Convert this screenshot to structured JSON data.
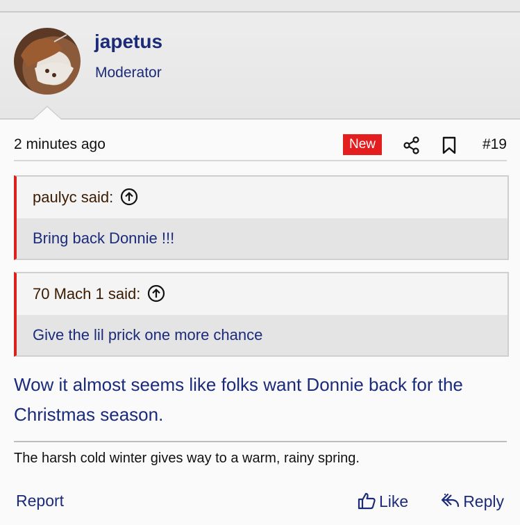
{
  "user": {
    "name": "japetus",
    "title": "Moderator"
  },
  "post": {
    "time": "2 minutes ago",
    "badge": "New",
    "number": "#19",
    "quotes": [
      {
        "author": "paulyc said:",
        "text": "Bring back Donnie !!!"
      },
      {
        "author": "70 Mach 1 said:",
        "text": "Give the lil prick one more chance"
      }
    ],
    "message": "Wow it almost seems like folks want Donnie back for the Christmas season.",
    "signature": "The harsh cold winter gives way to a warm, rainy spring."
  },
  "actions": {
    "report": "Report",
    "like": "Like",
    "reply": "Reply"
  },
  "colors": {
    "link": "#1b2b7a",
    "badge": "#e41e1e",
    "quote_bar": "#d9221c"
  },
  "icons": [
    "share-icon",
    "bookmark-icon",
    "arrow-up-circle-icon",
    "thumbs-up-icon",
    "reply-icon"
  ]
}
